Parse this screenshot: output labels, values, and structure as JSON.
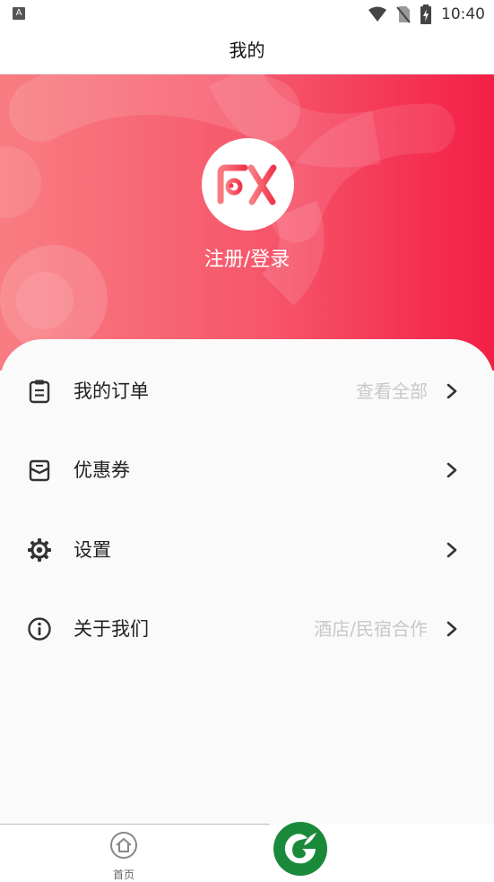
{
  "status_bar": {
    "time": "10:40",
    "notif_badge": "A"
  },
  "header": {
    "title": "我的"
  },
  "profile": {
    "login_text": "注册/登录"
  },
  "menu": [
    {
      "label": "我的订单",
      "extra": "查看全部",
      "icon": "clipboard-icon"
    },
    {
      "label": "优惠券",
      "extra": "",
      "icon": "envelope-icon"
    },
    {
      "label": "设置",
      "extra": "",
      "icon": "gear-icon"
    },
    {
      "label": "关于我们",
      "extra": "酒店/民宿合作",
      "icon": "info-icon"
    }
  ],
  "bottom_nav": {
    "home_label": "首页"
  },
  "colors": {
    "accent": "#f31f46",
    "hero_start": "#f87d82",
    "brand_green": "#1a8a3a"
  }
}
